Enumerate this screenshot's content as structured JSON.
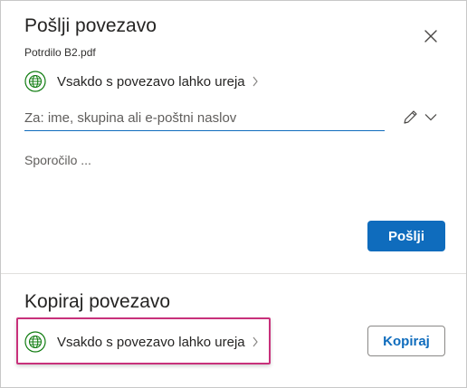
{
  "send_link": {
    "title": "Pošlji povezavo",
    "filename": "Potrdilo B2.pdf",
    "permission_label": "Vsakdo s povezavo lahko ureja",
    "to_placeholder": "Za: ime, skupina ali e-poštni naslov",
    "to_value": "",
    "message_placeholder": "Sporočilo ...",
    "send_label": "Pošlji"
  },
  "copy_link": {
    "title": "Kopiraj povezavo",
    "permission_label": "Vsakdo s povezavo lahko ureja",
    "copy_label": "Kopiraj"
  },
  "icons": {
    "close": "close-icon",
    "globe": "globe-icon",
    "chevron_right": "chevron-right-icon",
    "pencil": "pencil-icon",
    "chevron_down": "chevron-down-icon"
  },
  "colors": {
    "accent": "#0f6cbd",
    "globe_green": "#107c10",
    "highlight": "#c8317b"
  }
}
